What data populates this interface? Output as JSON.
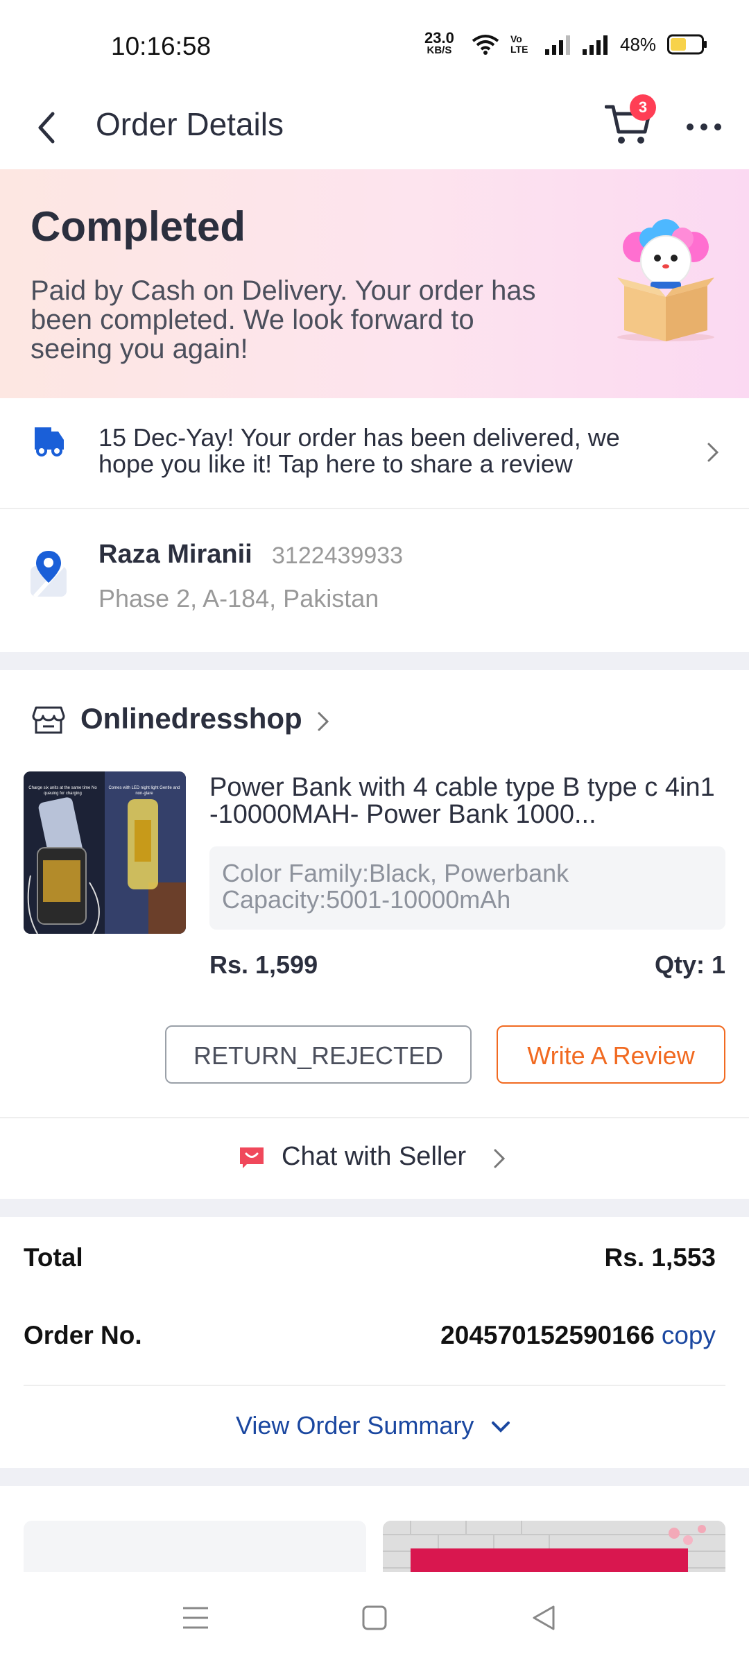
{
  "status_bar": {
    "time": "10:16:58",
    "net_speed": "23.0",
    "net_unit": "KB/S",
    "volte": "Vo LTE",
    "battery_percent": "48%"
  },
  "header": {
    "title": "Order Details",
    "cart_count": "3"
  },
  "banner": {
    "status": "Completed",
    "message": "Paid by Cash on Delivery. Your order has been completed. We look forward to seeing you again!"
  },
  "delivery": {
    "message": "15 Dec-Yay! Your order has been delivered, we hope you like it!  Tap here to share a review"
  },
  "address": {
    "name": "Raza Miranii",
    "phone": "3122439933",
    "line": "Phase 2, A-184, Pakistan"
  },
  "shop": {
    "name": "Onlinedresshop"
  },
  "product": {
    "title": "Power Bank with 4 cable type B type c 4in1 -10000MAH-  Power Bank 1000...",
    "variation": "Color Family:Black, Powerbank Capacity:5001-10000mAh",
    "price": "Rs. 1,599",
    "qty": "Qty: 1",
    "img_text_left": "Charge six units at the same time No queuing for charging",
    "img_text_right": "Comes with LED night light Gentle and non-glare"
  },
  "actions": {
    "return_label": "RETURN_REJECTED",
    "review_label": "Write A Review",
    "chat_label": "Chat with Seller"
  },
  "summary": {
    "total_label": "Total",
    "total_value": "Rs. 1,553",
    "order_label": "Order No.",
    "order_value": "204570152590166",
    "copy_label": "copy",
    "view_summary_label": "View Order Summary"
  },
  "colors": {
    "accent_orange": "#f16a21",
    "link_blue": "#1a47a0",
    "badge_red": "#ff3e55"
  }
}
